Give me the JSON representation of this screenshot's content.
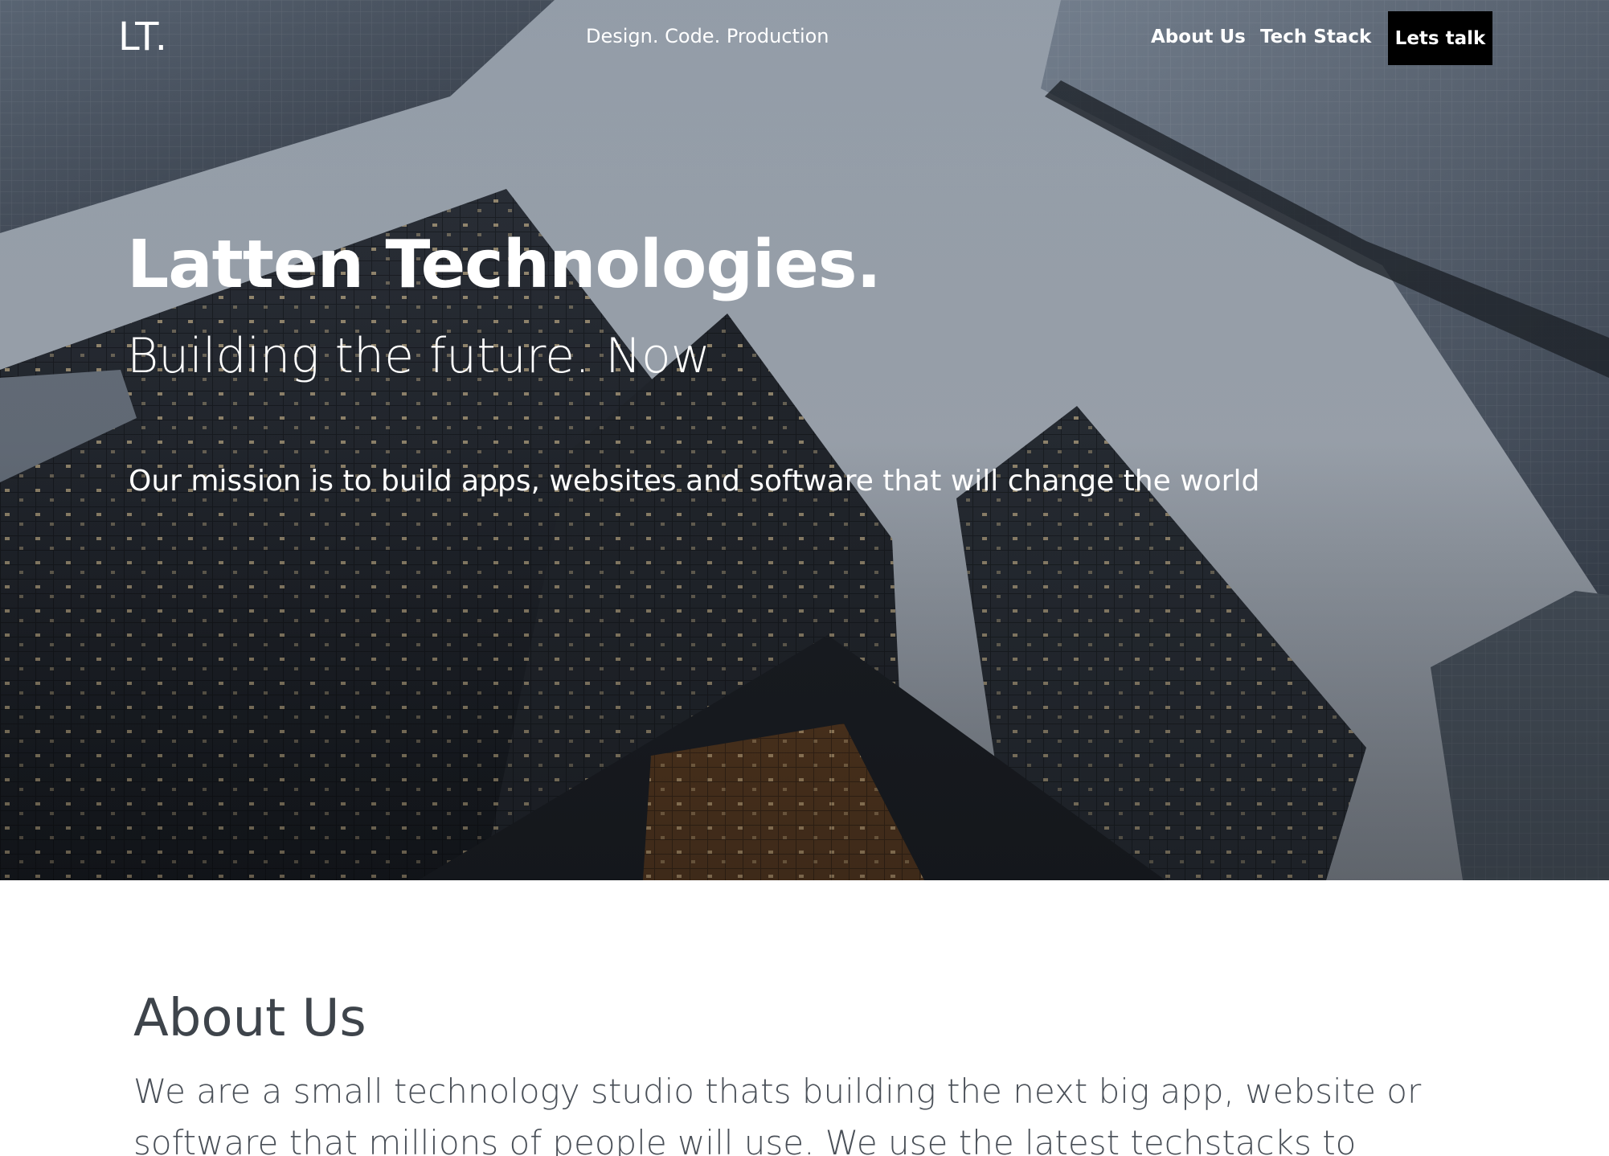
{
  "nav": {
    "logo": "LT.",
    "tagline": "Design. Code. Production",
    "links": [
      {
        "label": "About Us"
      },
      {
        "label": "Tech Stack"
      }
    ],
    "cta_label": "Lets talk"
  },
  "hero": {
    "title": "Latten Technologies.",
    "subtitle": "Building the future. Now",
    "mission": "Our mission is to build apps, websites and software that will change the world"
  },
  "about": {
    "title": "About Us",
    "body": "We are a small technology studio thats building the next big app, website or software that millions of people will use. We use the latest techstacks to"
  },
  "colors": {
    "cta_bg": "#000000",
    "hero_text": "#ffffff",
    "about_title": "#3e444b",
    "about_body": "#4a5058"
  }
}
